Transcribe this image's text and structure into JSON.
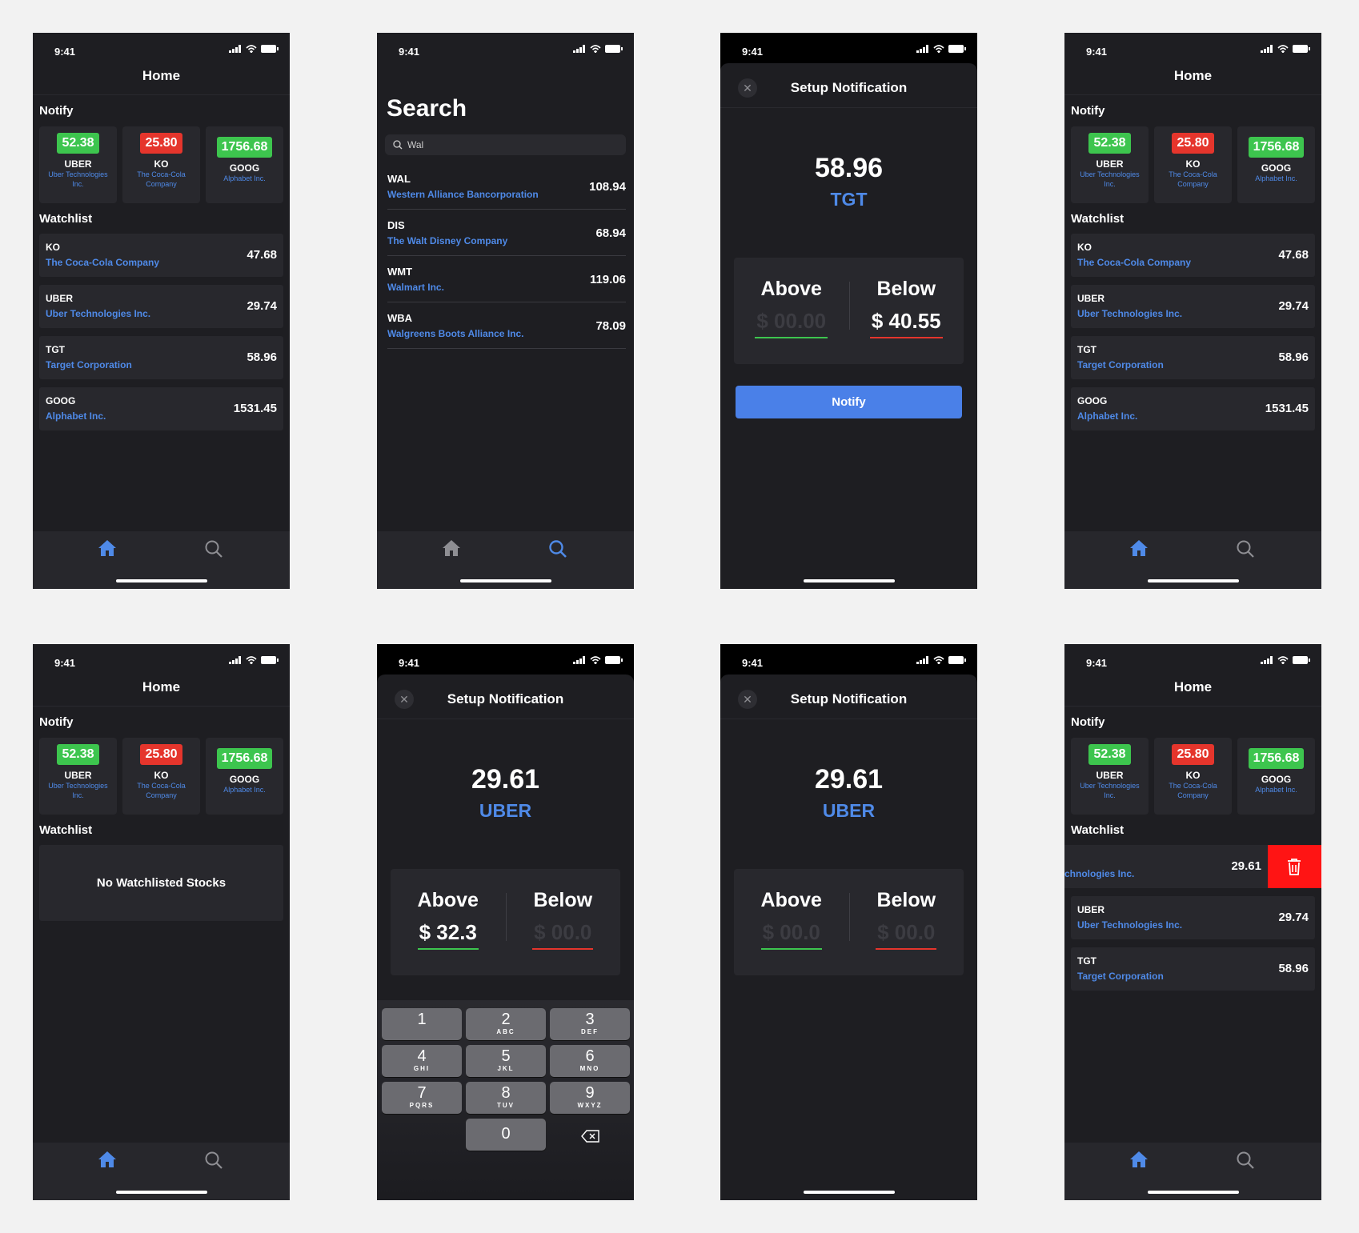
{
  "status": {
    "time": "9:41"
  },
  "tabs": {
    "home_icon": "house-icon",
    "search_icon": "magnifier-icon",
    "active_color": "#4f8ae8",
    "inactive_color": "#8e8e93"
  },
  "home": {
    "title": "Home",
    "notify_label": "Notify",
    "watchlist_label": "Watchlist",
    "notify_cards": [
      {
        "price": "52.38",
        "ticker": "UBER",
        "name": "Uber Technologies Inc.",
        "color": "green"
      },
      {
        "price": "25.80",
        "ticker": "KO",
        "name": "The Coca-Cola Company",
        "color": "red"
      },
      {
        "price": "1756.68",
        "ticker": "GOOG",
        "name": "Alphabet Inc.",
        "color": "green"
      }
    ],
    "watchlist": [
      {
        "ticker": "KO",
        "name": "The Coca-Cola Company",
        "price": "47.68"
      },
      {
        "ticker": "UBER",
        "name": "Uber Technologies Inc.",
        "price": "29.74"
      },
      {
        "ticker": "TGT",
        "name": "Target Corporation",
        "price": "58.96"
      },
      {
        "ticker": "GOOG",
        "name": "Alphabet Inc.",
        "price": "1531.45"
      }
    ],
    "empty_text": "No Watchlisted Stocks",
    "swipe_row": {
      "name": "chnologies Inc.",
      "price": "29.61"
    },
    "swipe_watchlist": [
      {
        "ticker": "UBER",
        "name": "Uber Technologies Inc.",
        "price": "29.74"
      },
      {
        "ticker": "TGT",
        "name": "Target Corporation",
        "price": "58.96"
      }
    ]
  },
  "search": {
    "title": "Search",
    "query": "Wal",
    "results": [
      {
        "ticker": "WAL",
        "name": "Western Alliance Bancorporation",
        "price": "108.94"
      },
      {
        "ticker": "DIS",
        "name": "The Walt Disney Company",
        "price": "68.94"
      },
      {
        "ticker": "WMT",
        "name": "Walmart Inc.",
        "price": "119.06"
      },
      {
        "ticker": "WBA",
        "name": "Walgreens Boots Alliance Inc.",
        "price": "78.09"
      }
    ]
  },
  "setup": {
    "title": "Setup Notification",
    "close": "✕",
    "above_label": "Above",
    "below_label": "Below",
    "notify_button": "Notify",
    "tgt": {
      "price": "58.96",
      "ticker": "TGT",
      "above": "$ 00.00",
      "below": "$ 40.55"
    },
    "uber_entry": {
      "price": "29.61",
      "ticker": "UBER",
      "above": "$ 32.3",
      "below": "$ 00.0"
    },
    "uber_empty": {
      "price": "29.61",
      "ticker": "UBER",
      "above": "$ 00.0",
      "below": "$ 00.0"
    }
  },
  "keypad": [
    {
      "d": "1",
      "l": ""
    },
    {
      "d": "2",
      "l": "ABC"
    },
    {
      "d": "3",
      "l": "DEF"
    },
    {
      "d": "4",
      "l": "GHI"
    },
    {
      "d": "5",
      "l": "JKL"
    },
    {
      "d": "6",
      "l": "MNO"
    },
    {
      "d": "7",
      "l": "PQRS"
    },
    {
      "d": "8",
      "l": "TUV"
    },
    {
      "d": "9",
      "l": "WXYZ"
    },
    {
      "d": "0",
      "l": ""
    }
  ]
}
